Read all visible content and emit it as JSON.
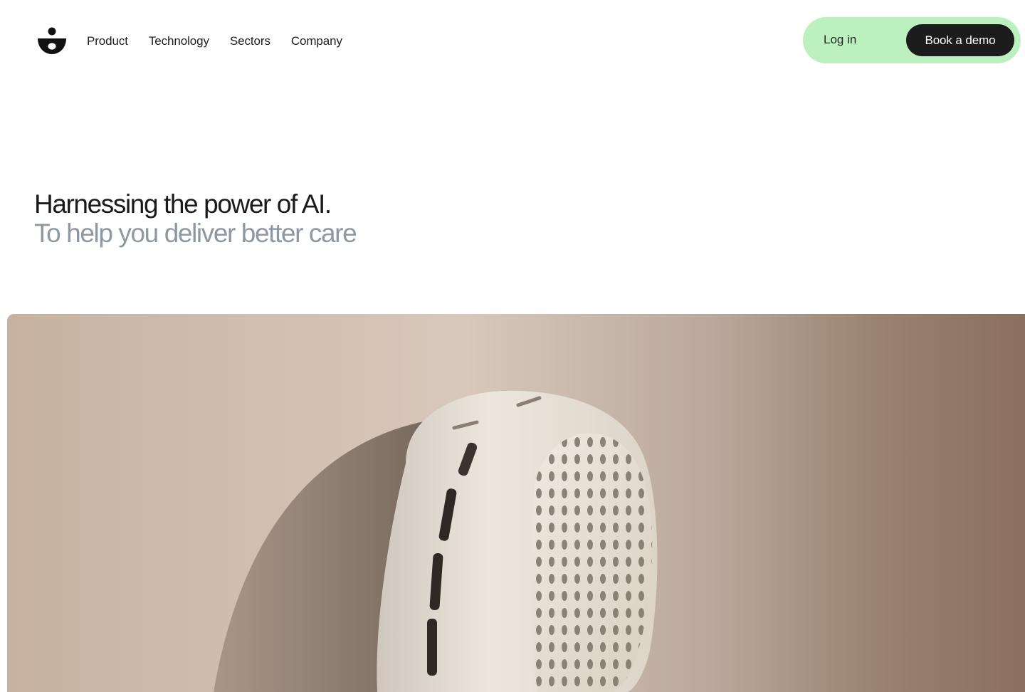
{
  "header": {
    "logo": "brand-logo",
    "nav": {
      "product": "Product",
      "technology": "Technology",
      "sectors": "Sectors",
      "company": "Company"
    },
    "login_label": "Log in",
    "demo_label": "Book a demo"
  },
  "hero": {
    "title": "Harnessing the power of AI.",
    "subtitle": "To help you deliver better care"
  },
  "colors": {
    "accent_green": "#bdf0bf",
    "dark": "#1c1c1c",
    "subtitle_grey": "#8e98a3"
  }
}
